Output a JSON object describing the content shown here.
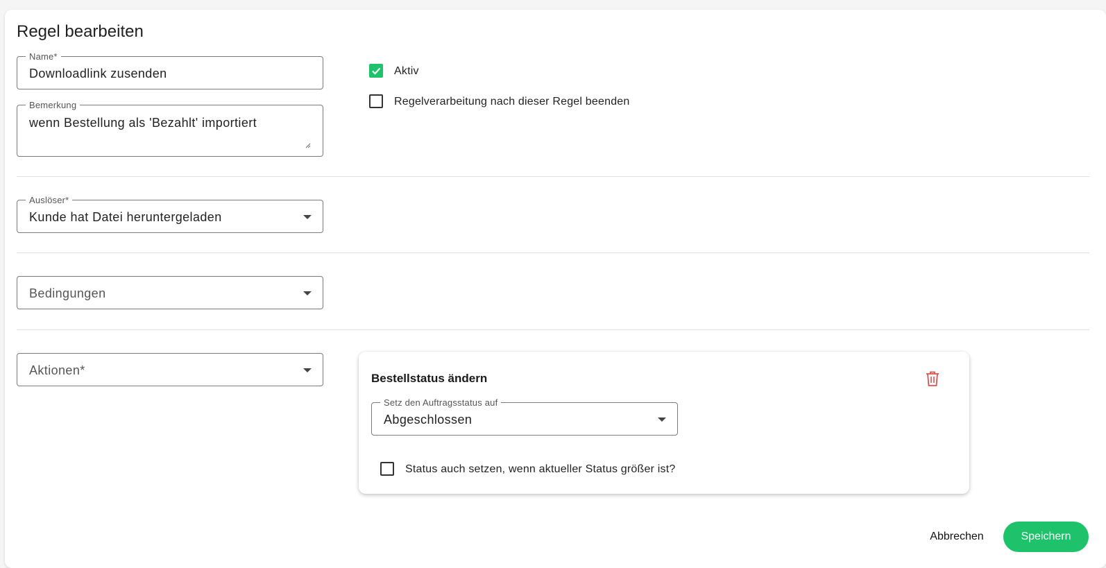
{
  "dialog": {
    "title": "Regel bearbeiten"
  },
  "form": {
    "name": {
      "label": "Name*",
      "value": "Downloadlink zusenden"
    },
    "remark": {
      "label": "Bemerkung",
      "value": "wenn Bestellung als 'Bezahlt' importiert"
    },
    "active": {
      "label": "Aktiv",
      "checked": true
    },
    "stop_processing": {
      "label": "Regelverarbeitung nach dieser Regel beenden",
      "checked": false
    },
    "trigger": {
      "label": "Auslöser*",
      "value": "Kunde hat Datei heruntergeladen"
    },
    "conditions": {
      "placeholder": "Bedingungen"
    },
    "actions": {
      "placeholder": "Aktionen*"
    }
  },
  "action_card": {
    "title": "Bestellstatus ändern",
    "status_select": {
      "label": "Setz den Auftragsstatus auf",
      "value": "Abgeschlossen"
    },
    "force_status": {
      "label": "Status auch setzen, wenn aktueller Status größer ist?",
      "checked": false
    }
  },
  "buttons": {
    "cancel": "Abbrechen",
    "save": "Speichern"
  },
  "colors": {
    "accent": "#1ec26b",
    "danger": "#d9534f"
  }
}
